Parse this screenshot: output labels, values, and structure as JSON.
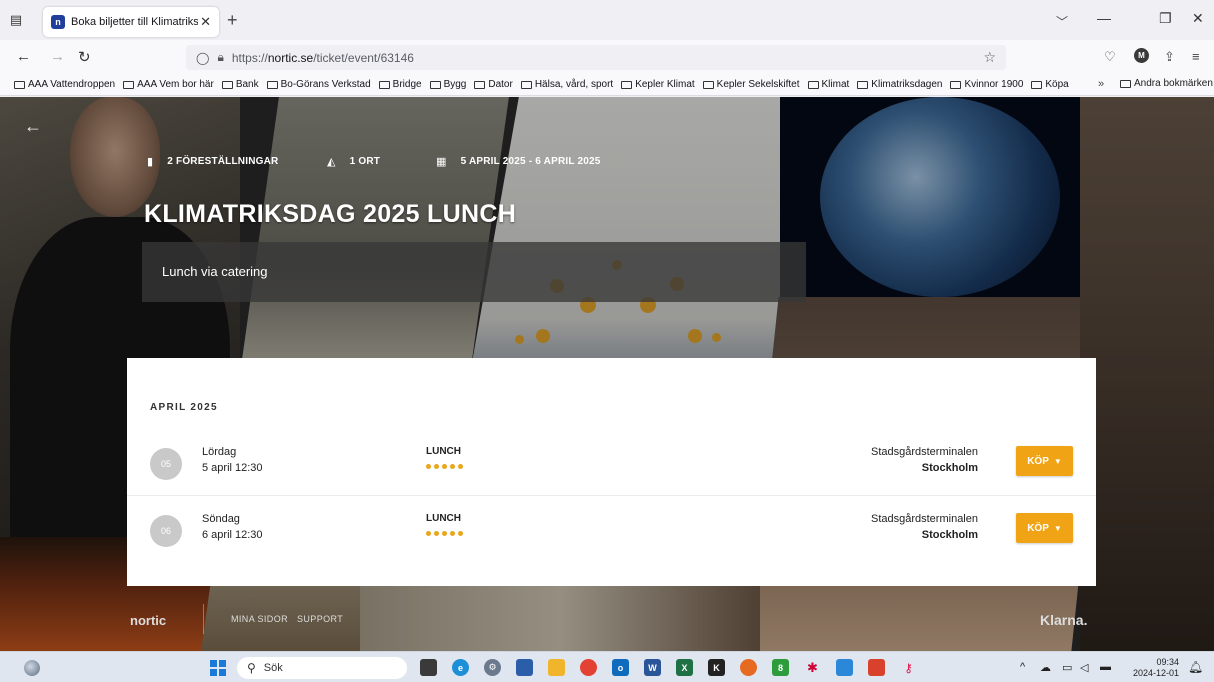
{
  "browser": {
    "tab_title": "Boka biljetter till Klimatriksdag",
    "tab_close": "✕",
    "new_tab": "+",
    "url_prefix": "https://",
    "url_domain": "nortic.se",
    "url_path": "/ticket/event/63146",
    "bookmarks": [
      "AAA Vattendroppen",
      "AAA Vem bor här",
      "Bank",
      "Bo-Görans Verkstad",
      "Bridge",
      "Bygg",
      "Dator",
      "Hälsa, vård, sport",
      "Kepler Klimat",
      "Kepler Sekelskiftet",
      "Klimat",
      "Klimatriksdagen",
      "Kvinnor 1900",
      "Köpa"
    ],
    "bookmarks_more": "»",
    "other_bookmarks": "Andra bokmärken"
  },
  "event": {
    "performances": "2 FÖRESTÄLLNINGAR",
    "locations": "1 ORT",
    "dates": "5 APRIL 2025 - 6 APRIL 2025",
    "title": "KLIMATRIKSDAG 2025 LUNCH",
    "description": "Lunch via catering"
  },
  "schedule": {
    "month": "APRIL 2025",
    "rows": [
      {
        "day": "05",
        "weekday": "Lördag",
        "datetime": "5 april 12:30",
        "show": "LUNCH",
        "venue": "Stadsgårdsterminalen",
        "city": "Stockholm",
        "buy": "KÖP"
      },
      {
        "day": "06",
        "weekday": "Söndag",
        "datetime": "6 april 12:30",
        "show": "LUNCH",
        "venue": "Stadsgårdsterminalen",
        "city": "Stockholm",
        "buy": "KÖP"
      }
    ]
  },
  "footer": {
    "logo": "nortic",
    "my_pages": "MINA SIDOR",
    "support": "SUPPORT",
    "klarna": "Klarna."
  },
  "taskbar": {
    "search": "Sök",
    "time": "09:34",
    "date": "2024-12-01"
  },
  "colors": {
    "buy_button": "#f0a315",
    "availability_dots": "#e9a51c",
    "card_bg": "#ffffff"
  },
  "icons": {
    "performances": "bookmark-icon",
    "locations": "map-icon",
    "dates": "calendar-icon"
  }
}
